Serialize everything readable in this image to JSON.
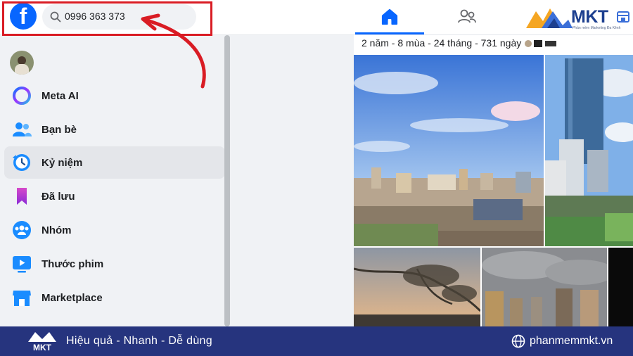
{
  "header": {
    "logo_letter": "f",
    "search_value": "0996 363 373",
    "brand": {
      "name": "MKT",
      "tagline": "Phần mềm Marketing Đa Kênh"
    }
  },
  "sidebar": {
    "items": [
      {
        "label": "Meta AI",
        "icon": "meta-ai-icon"
      },
      {
        "label": "Bạn bè",
        "icon": "friends-icon"
      },
      {
        "label": "Kỷ niệm",
        "icon": "memories-clock-icon",
        "active": true
      },
      {
        "label": "Đã lưu",
        "icon": "bookmark-icon"
      },
      {
        "label": "Nhóm",
        "icon": "groups-icon"
      },
      {
        "label": "Thước phim",
        "icon": "video-icon"
      },
      {
        "label": "Marketplace",
        "icon": "marketplace-icon"
      }
    ]
  },
  "memories": {
    "summary": "2 năm - 8 mùa - 24 tháng - 731 ngày"
  },
  "footer": {
    "logo_text": "MKT",
    "slogan": "Hiệu quả - Nhanh - Dễ dùng",
    "url": "phanmemmkt.vn"
  },
  "colors": {
    "facebook_blue": "#0866ff",
    "annotation_red": "#d91c24",
    "footer_navy": "#26347e",
    "brand_orange": "#f5a623"
  }
}
